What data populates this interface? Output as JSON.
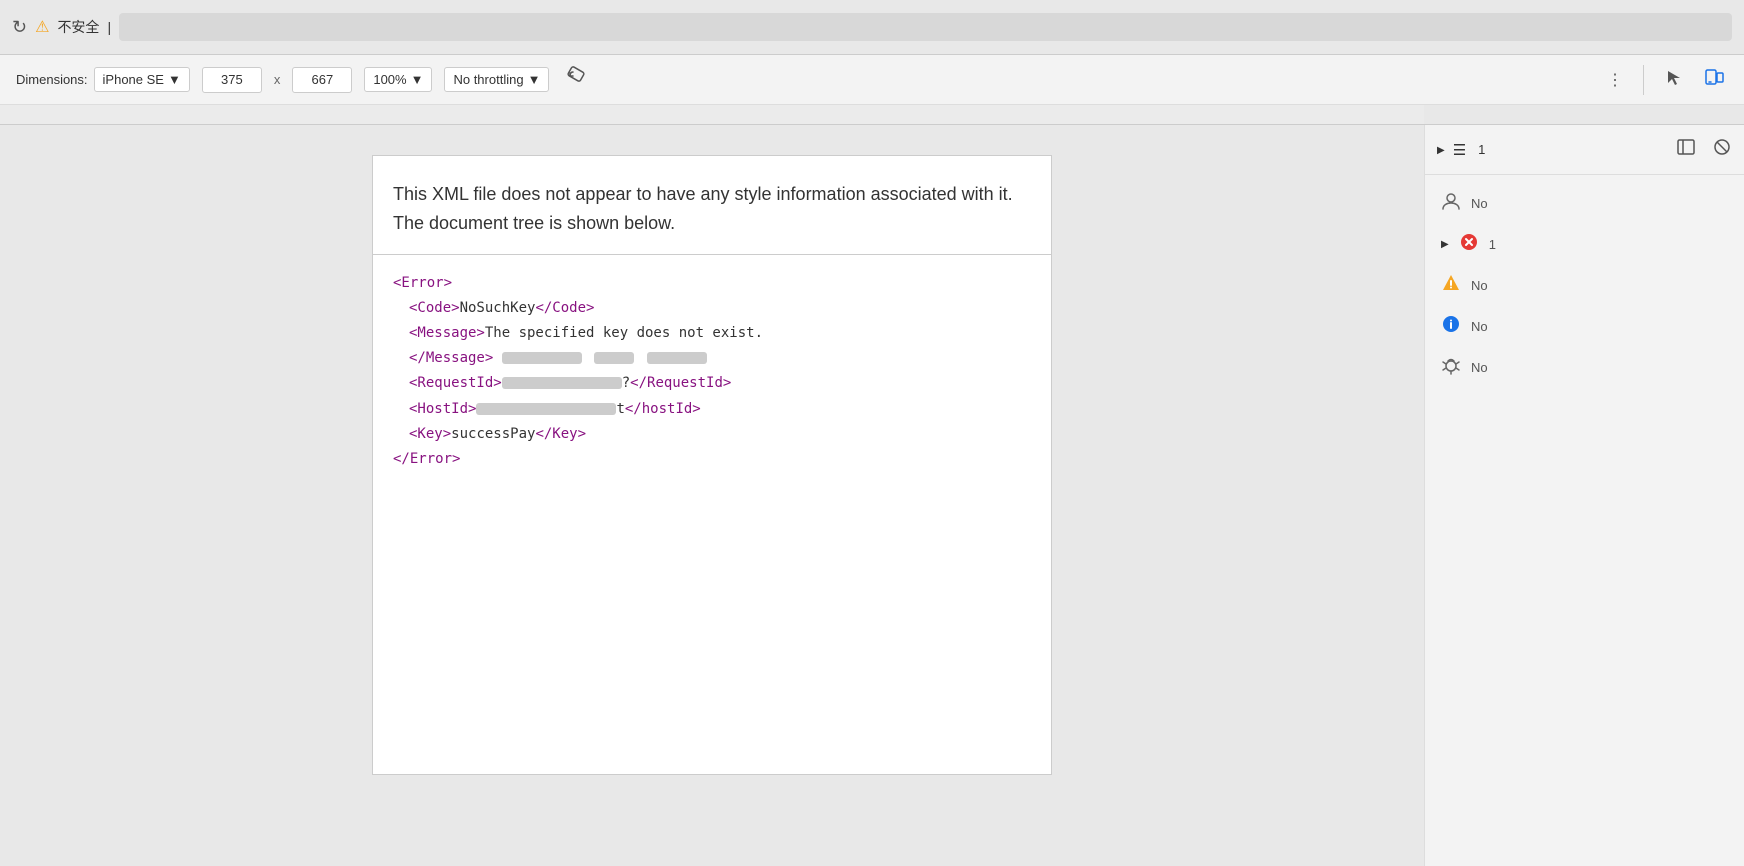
{
  "browser": {
    "reload_label": "↻",
    "warning_label": "⚠",
    "insecure_text": "不安全",
    "separator": "|"
  },
  "devtools_toolbar": {
    "dimensions_label": "Dimensions:",
    "device_name": "iPhone SE",
    "chevron": "▼",
    "width": "375",
    "x_label": "x",
    "height": "667",
    "zoom": "100%",
    "throttling": "No throttling",
    "rotate_label": "⟳"
  },
  "xml_content": {
    "message": "This XML file does not appear to have any style information associated with it. The document tree is shown below.",
    "lines": [
      {
        "indent": 0,
        "text": "<Error>"
      },
      {
        "indent": 1,
        "text": "<Code>NoSuchKey</Code>"
      },
      {
        "indent": 1,
        "text": "<Message>The specified key does not exist."
      },
      {
        "indent": 1,
        "text": "</Message>"
      },
      {
        "indent": 1,
        "text": "<RequestId>",
        "blurred": true,
        "blurred_text": "?</RequestId>"
      },
      {
        "indent": 1,
        "text": "<HostId>",
        "blurred2": true,
        "blurred_text2": "t</hostId>"
      },
      {
        "indent": 1,
        "text": "<Key>successPay</Key>"
      },
      {
        "indent": 0,
        "text": "</Error>"
      }
    ]
  },
  "side_panel": {
    "toggle_label": "▶",
    "list_label": "☰",
    "counter": "1",
    "items": [
      {
        "icon": "👤",
        "icon_type": "user",
        "text": "No"
      },
      {
        "icon": "✕",
        "icon_type": "error",
        "text": "1"
      },
      {
        "icon": "⚠",
        "icon_type": "warning",
        "text": "No"
      },
      {
        "icon": "ℹ",
        "icon_type": "info",
        "text": "No"
      },
      {
        "icon": "🐛",
        "icon_type": "debug",
        "text": "No"
      }
    ]
  },
  "icons": {
    "rotate": "⟳",
    "dots_vertical": "⋮",
    "cursor": "↖",
    "device_toggle": "⬚",
    "panel_left": "⬛",
    "block": "⊘"
  }
}
